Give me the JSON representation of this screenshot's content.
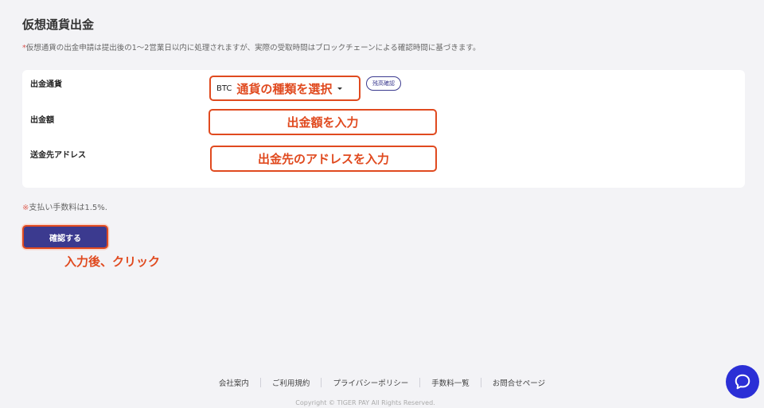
{
  "page": {
    "title": "仮想通貨出金",
    "notice_mark": "*",
    "notice": "仮想通貨の出金申請は提出後の1〜2営業日以内に処理されますが、実際の受取時間はブロックチェーンによる確認時間に基づきます。"
  },
  "form": {
    "currency_label": "出金通貨",
    "currency_value": "BTC",
    "currency_hint": "通貨の種類を選択",
    "balance_button": "残高確認",
    "amount_label": "出金額",
    "amount_hint": "出金額を入力",
    "address_label": "送金先アドレス",
    "address_hint": "出金先のアドレスを入力"
  },
  "fee": {
    "mark": "※",
    "text": "支払い手数料は1.5%."
  },
  "confirm": {
    "label": "確認する",
    "annotation": "入力後、クリック"
  },
  "footer": {
    "links": [
      "会社案内",
      "ご利用規約",
      "プライバシーポリシー",
      "手数料一覧",
      "お問合せページ"
    ],
    "copyright": "Copyright © TIGER PAY All Rights Reserved."
  },
  "chat": {
    "icon": "chat-bubble-icon",
    "color": "#2b2fd6"
  },
  "colors": {
    "accent": "#3b3a8f",
    "annotation": "#e04a1f"
  }
}
